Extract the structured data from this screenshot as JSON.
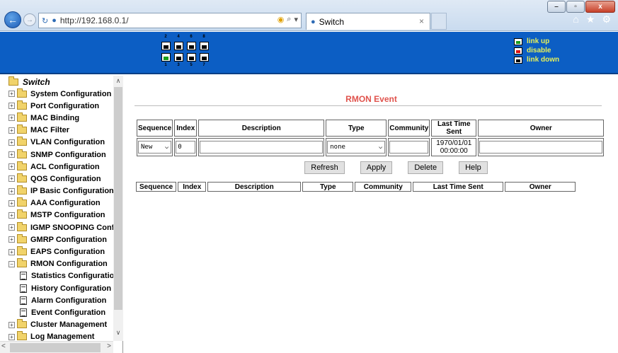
{
  "browser": {
    "url": "http://192.168.0.1/",
    "tab_title": "Switch",
    "tab_close": "×",
    "title_buttons": {
      "minimize": "–",
      "maximize": "▫",
      "close": "x"
    }
  },
  "device": {
    "port_numbers_top": [
      "2",
      "4",
      "6",
      "8"
    ],
    "port_numbers_bottom": [
      "1",
      "3",
      "5",
      "7"
    ],
    "top_row_status": [
      "down",
      "down",
      "down",
      "down"
    ],
    "bottom_row_status": [
      "up",
      "down",
      "down",
      "down"
    ],
    "legend": [
      {
        "label": "link up",
        "state": "up"
      },
      {
        "label": "disable",
        "state": "disable"
      },
      {
        "label": "link down",
        "state": "down"
      }
    ],
    "colors": {
      "header_bg": "#0c5ec4",
      "legend_text": "#e6f05a",
      "link_up": "#1a9e1a",
      "disable": "#d11111"
    }
  },
  "sidebar": {
    "root": "Switch",
    "items": [
      {
        "label": "System Configuration",
        "type": "folder"
      },
      {
        "label": "Port Configuration",
        "type": "folder"
      },
      {
        "label": "MAC Binding",
        "type": "folder"
      },
      {
        "label": "MAC Filter",
        "type": "folder"
      },
      {
        "label": "VLAN Configuration",
        "type": "folder"
      },
      {
        "label": "SNMP Configuration",
        "type": "folder"
      },
      {
        "label": "ACL Configuration",
        "type": "folder"
      },
      {
        "label": "QOS Configuration",
        "type": "folder"
      },
      {
        "label": "IP Basic Configuration",
        "type": "folder"
      },
      {
        "label": "AAA Configuration",
        "type": "folder"
      },
      {
        "label": "MSTP Configuration",
        "type": "folder"
      },
      {
        "label": "IGMP SNOOPING Confi",
        "type": "folder"
      },
      {
        "label": "GMRP Configuration",
        "type": "folder"
      },
      {
        "label": "EAPS Configuration",
        "type": "folder"
      },
      {
        "label": "RMON Configuration",
        "type": "folder-open"
      },
      {
        "label": "Statistics Configuratio",
        "type": "leaf"
      },
      {
        "label": "History Configuration",
        "type": "leaf"
      },
      {
        "label": "Alarm Configuration",
        "type": "leaf"
      },
      {
        "label": "Event Configuration",
        "type": "leaf"
      },
      {
        "label": "Cluster Management",
        "type": "folder"
      },
      {
        "label": "Log Management",
        "type": "folder"
      }
    ]
  },
  "main": {
    "title": "RMON Event",
    "edit_headers": [
      "Sequence",
      "Index",
      "Description",
      "Type",
      "Community",
      "Last Time Sent",
      "Owner"
    ],
    "edit_row": {
      "sequence": "New",
      "index": "0",
      "description": "",
      "type": "none",
      "community": "",
      "last_time_sent_date": "1970/01/01",
      "last_time_sent_time": "00:00:00",
      "owner": ""
    },
    "buttons": {
      "refresh": "Refresh",
      "apply": "Apply",
      "delete": "Delete",
      "help": "Help"
    },
    "list_headers": [
      "Sequence",
      "Index",
      "Description",
      "Type",
      "Community",
      "Last Time Sent",
      "Owner"
    ],
    "title_color": "#e0534d"
  }
}
